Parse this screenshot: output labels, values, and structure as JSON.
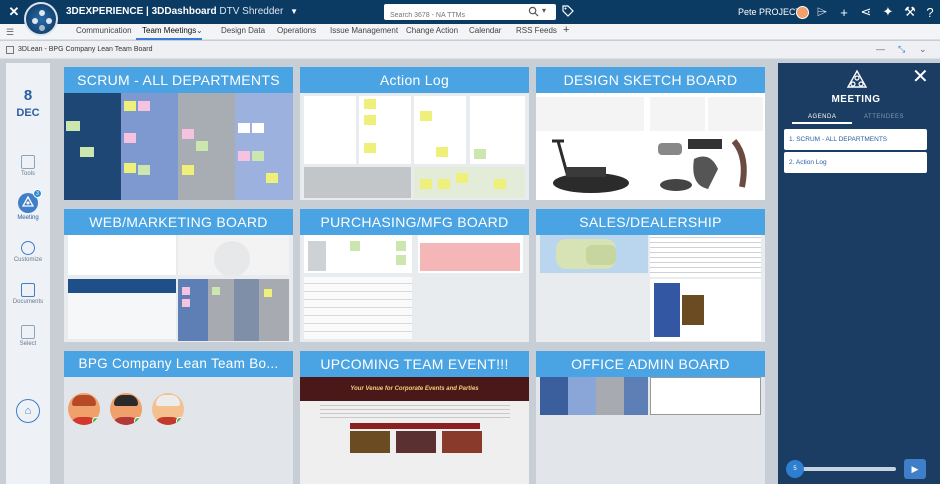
{
  "topbar": {
    "app_name": "3DEXPERIENCE | 3DDashboard",
    "dashboard_name": "DTV Shredder",
    "search_placeholder": "Search 3678 - NA TTMs",
    "user_name": "Pete PROJECT"
  },
  "tabs": [
    {
      "label": "Communication"
    },
    {
      "label": "Team Meetings"
    },
    {
      "label": "Design Data"
    },
    {
      "label": "Operations"
    },
    {
      "label": "Issue Management"
    },
    {
      "label": "Change Action"
    },
    {
      "label": "Calendar"
    },
    {
      "label": "RSS Feeds"
    }
  ],
  "tabs_add": "+",
  "breadcrumb": "3DLean - BPG Company Lean Team Board",
  "leftnav": {
    "day": "8",
    "month": "DEC",
    "items": [
      {
        "label": "Tools",
        "icon": "tools-icon"
      },
      {
        "label": "Meeting",
        "icon": "meeting-icon",
        "badge": "3"
      },
      {
        "label": "Customize",
        "icon": "gear-icon"
      },
      {
        "label": "Documents",
        "icon": "document-icon"
      },
      {
        "label": "Select",
        "icon": "select-icon"
      }
    ]
  },
  "boards": [
    {
      "title": "SCRUM - ALL DEPARTMENTS"
    },
    {
      "title": "Action Log"
    },
    {
      "title": "DESIGN SKETCH BOARD"
    },
    {
      "title": "WEB/MARKETING BOARD"
    },
    {
      "title": "PURCHASING/MFG BOARD"
    },
    {
      "title": "SALES/DEALERSHIP"
    },
    {
      "title": "BPG Company Lean Team Bo..."
    },
    {
      "title": "UPCOMING TEAM EVENT!!!"
    },
    {
      "title": "OFFICE ADMIN BOARD"
    }
  ],
  "event_page": {
    "heading": "Your Venue for Corporate Events and Parties"
  },
  "meeting": {
    "title": "MEETING",
    "tab_agenda": "AGENDA",
    "tab_attendees": "ATTENDEES",
    "agenda": [
      {
        "label": "1. SCRUM - ALL DEPARTMENTS"
      },
      {
        "label": "2. Action Log"
      }
    ],
    "slider_value": "5"
  },
  "colors": {
    "topbar": "#0b3a63",
    "board_header": "#4aa3e2",
    "meeting_panel": "#1b3d63",
    "accent": "#3f7ec8"
  }
}
